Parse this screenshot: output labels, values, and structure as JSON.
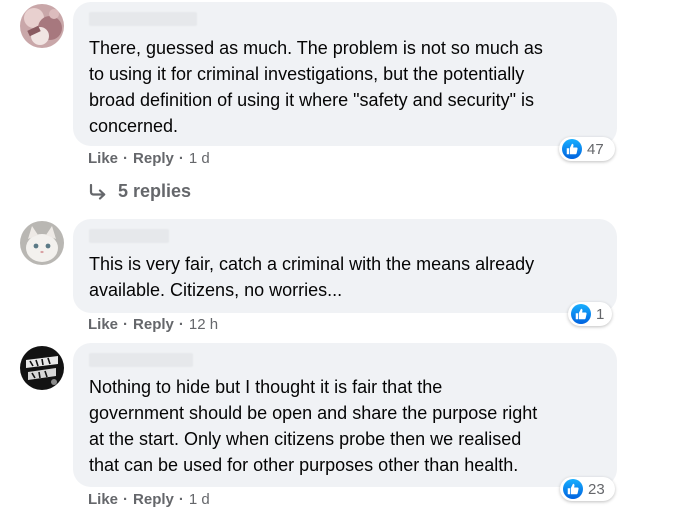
{
  "comments": [
    {
      "text": "There, guessed as much. The problem is not so much as\nto using it for criminal investigations, but the potentially\nbroad definition of using it where \"safety and security\" is\nconcerned.",
      "reactions": "47",
      "like_label": "Like",
      "reply_label": "Reply",
      "time": "1 d",
      "replies_label": "5 replies"
    },
    {
      "text": "This is very fair, catch a criminal with the means already\navailable. Citizens, no worries...",
      "reactions": "1",
      "like_label": "Like",
      "reply_label": "Reply",
      "time": "12 h"
    },
    {
      "text": "Nothing to hide but I thought it is fair that the\ngovernment should be open and share the purpose right\nat the start. Only when citizens probe then we realised\nthat can be used for other purposes other than health.",
      "reactions": "23",
      "like_label": "Like",
      "reply_label": "Reply",
      "time": "1 d"
    }
  ],
  "colors": {
    "bubble": "#f0f2f5",
    "meta_text": "#65676b",
    "like_blue": "#1877f2"
  },
  "icons": {
    "like": "thumbs-up-icon",
    "reply_arrow": "reply-arrow-icon"
  }
}
